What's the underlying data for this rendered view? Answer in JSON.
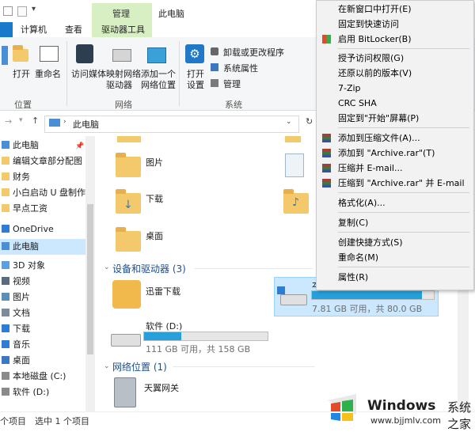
{
  "title_bar": {
    "context_group": "管理",
    "location": "此电脑"
  },
  "ribbon_tabs": {
    "file": "",
    "computer": "计算机",
    "view": "查看",
    "drive_tools": "驱动器工具"
  },
  "ribbon": {
    "location_group": {
      "label": "位置",
      "open": "打开",
      "rename": "重命名"
    },
    "network_group": {
      "label": "网络",
      "access_media": "访问媒体",
      "map_drive_1": "映射网络",
      "map_drive_2": "驱动器",
      "add_location_1": "添加一个",
      "add_location_2": "网络位置"
    },
    "system_group": {
      "label": "系统",
      "open_settings_1": "打开",
      "open_settings_2": "设置",
      "uninstall": "卸载或更改程序",
      "properties": "系统属性",
      "manage": "管理"
    }
  },
  "address": {
    "path": "此电脑"
  },
  "nav_pane": {
    "items": [
      {
        "label": "此电脑",
        "color": "#4a8fd6"
      },
      {
        "label": "编辑文章部分配图",
        "color": "#f3c96b"
      },
      {
        "label": "财务",
        "color": "#f3c96b"
      },
      {
        "label": "小白启动 U 盘制作步",
        "color": "#f3c96b"
      },
      {
        "label": "早点工资",
        "color": "#f3c96b"
      },
      {
        "label": "OneDrive",
        "color": "#2f7cd3"
      },
      {
        "label": "此电脑",
        "color": "#4a8fd6"
      },
      {
        "label": "3D 对象",
        "color": "#5aa0e0"
      },
      {
        "label": "视频",
        "color": "#5a6b7d"
      },
      {
        "label": "图片",
        "color": "#5a8fb8"
      },
      {
        "label": "文档",
        "color": "#7d8c9a"
      },
      {
        "label": "下载",
        "color": "#2f7cd3"
      },
      {
        "label": "音乐",
        "color": "#2f7cd3"
      },
      {
        "label": "桌面",
        "color": "#3a78c0"
      },
      {
        "label": "本地磁盘 (C:)",
        "color": "#8a8a8a"
      },
      {
        "label": "软件 (D:)",
        "color": "#8a8a8a"
      }
    ]
  },
  "folders": {
    "pictures": "图片",
    "downloads": "下载",
    "desktop": "桌面"
  },
  "devices": {
    "heading": "设备和驱动器 (3)",
    "thunder": "迅雷下载",
    "drive_c_name": "本",
    "drive_c_caption": "7.81 GB 可用，共 80.0 GB",
    "drive_c_used": 0.9,
    "drive_d_name": "软件 (D:)",
    "drive_d_caption": "111 GB 可用，共 158 GB",
    "drive_d_used": 0.3
  },
  "network": {
    "heading": "网络位置 (1)",
    "router": "天翼网关"
  },
  "status": {
    "count": "个项目",
    "selected": "选中 1 个项目"
  },
  "context_menu": {
    "items": [
      "在新窗口中打开(E)",
      "固定到快速访问",
      "启用 BitLocker(B)",
      "授予访问权限(G)",
      "还原以前的版本(V)",
      "7-Zip",
      "CRC SHA",
      "固定到\"开始\"屏幕(P)",
      "添加到压缩文件(A)...",
      "添加到 \"Archive.rar\"(T)",
      "压缩并 E-mail...",
      "压缩到 \"Archive.rar\" 并 E-mail",
      "格式化(A)...",
      "复制(C)",
      "创建快捷方式(S)",
      "重命名(M)",
      "属性(R)"
    ]
  },
  "watermark": {
    "title": "Windows",
    "subtitle": "系统之家",
    "url": "www.bjjmlv.com"
  },
  "colors": {
    "accent": "#1979ca",
    "context_tab": "#d8efc4",
    "progress": "#26a0da",
    "selection": "#cce8ff"
  }
}
